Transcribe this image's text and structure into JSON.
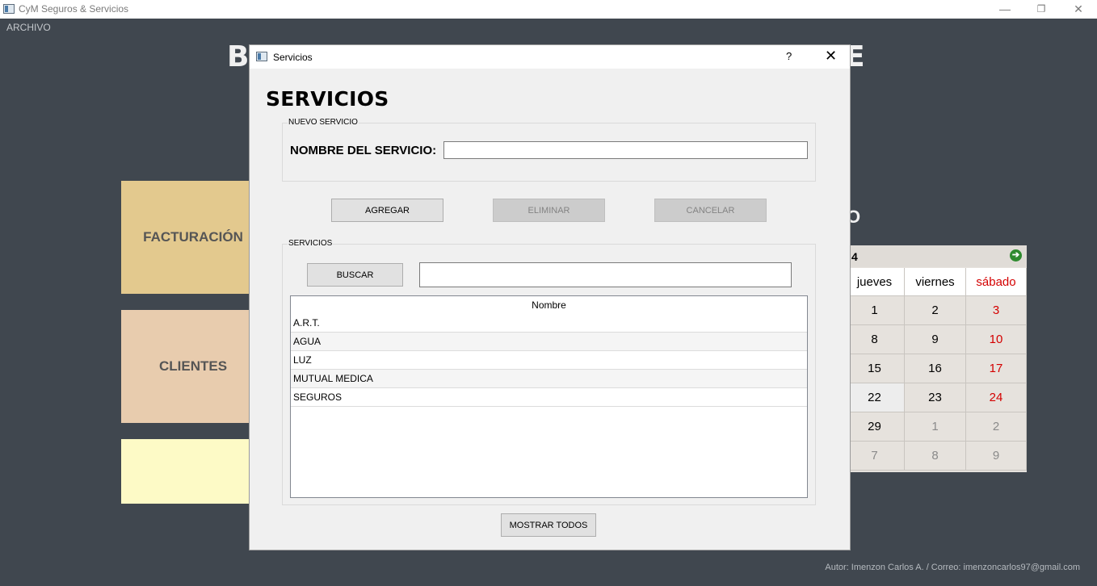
{
  "window": {
    "title": "CyM Seguros & Servicios",
    "controls": {
      "minimize": "—",
      "restore": "❐",
      "close": "✕"
    }
  },
  "menu": {
    "archivo": "ARCHIVO"
  },
  "background": {
    "title_left": "B",
    "title_right": "E",
    "tiles": {
      "facturacion": {
        "label": "FACTURACIÓN",
        "color": "#e3c98e"
      },
      "clientes": {
        "label": "CLIENTES",
        "color": "#e8ccae"
      },
      "third": {
        "label": "",
        "color": "#fdfac6"
      }
    },
    "calendar_heading": "O",
    "calendar": {
      "month_fragment": "4",
      "weekdays": [
        "jueves",
        "viernes",
        "sábado"
      ],
      "weeks": [
        [
          "1",
          "2",
          "3"
        ],
        [
          "8",
          "9",
          "10"
        ],
        [
          "15",
          "16",
          "17"
        ],
        [
          "22",
          "23",
          "24"
        ],
        [
          "29",
          "1",
          "2"
        ],
        [
          "7",
          "8",
          "9"
        ]
      ],
      "weekend_color": "#d40000"
    },
    "footer": "Autor: Imenzon Carlos A. / Correo: imenzoncarlos97@gmail.com"
  },
  "dialog": {
    "title": "Servicios",
    "help": "?",
    "close": "✕",
    "heading": "SERVICIOS",
    "new_group_label": "NUEVO SERVICIO",
    "field_label": "NOMBRE DEL SERVICIO:",
    "name_value": "",
    "buttons": {
      "agregar": "AGREGAR",
      "eliminar": "ELIMINAR",
      "cancelar": "CANCELAR",
      "buscar": "BUSCAR",
      "mostrar_todos": "MOSTRAR TODOS"
    },
    "list_group_label": "SERVICIOS",
    "search_value": "",
    "table": {
      "column": "Nombre",
      "rows": [
        "A.R.T.",
        "AGUA",
        "LUZ",
        "MUTUAL MEDICA",
        "SEGUROS"
      ]
    }
  }
}
